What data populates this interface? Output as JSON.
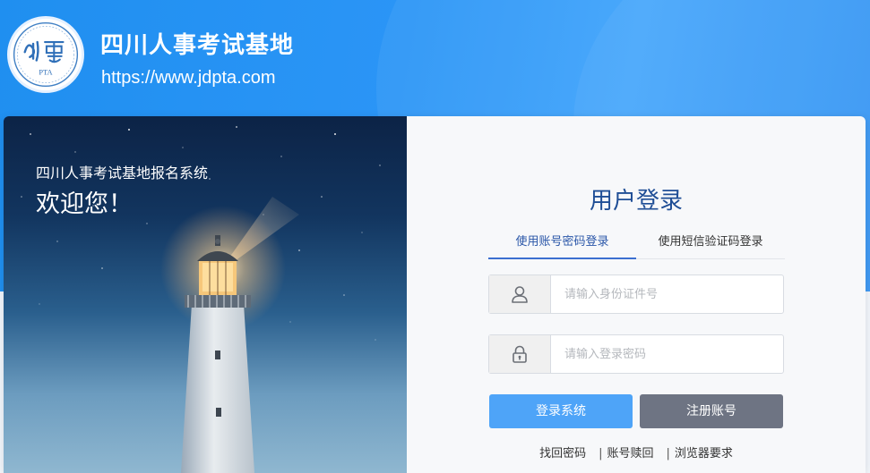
{
  "header": {
    "title": "四川人事考试基地",
    "url": "https://www.jdpta.com",
    "logo_text": "PTA"
  },
  "hero": {
    "subtitle": "四川人事考试基地报名系统",
    "welcome": "欢迎您！"
  },
  "login": {
    "title": "用户登录",
    "tabs": [
      {
        "label": "使用账号密码登录",
        "active": true
      },
      {
        "label": "使用短信验证码登录",
        "active": false
      }
    ],
    "username": {
      "icon": "user-icon",
      "placeholder": "请输入身份证件号",
      "value": ""
    },
    "password": {
      "icon": "lock-icon",
      "placeholder": "请输入登录密码",
      "value": ""
    },
    "login_button": "登录系统",
    "register_button": "注册账号",
    "links": [
      "找回密码",
      "账号赎回",
      "浏览器要求"
    ],
    "link_separator": "|"
  },
  "colors": {
    "header_blue": "#2b95f6",
    "title_blue": "#1f4e96",
    "login_button": "#4ea4f8",
    "register_button": "#6e7483",
    "active_tab": "#3b6fd0"
  }
}
